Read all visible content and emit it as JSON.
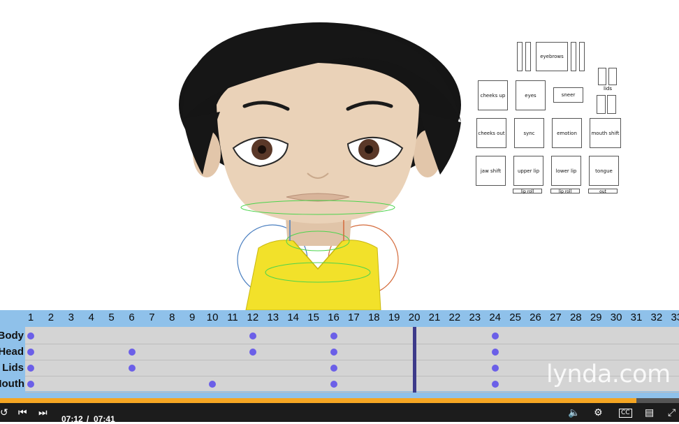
{
  "timeline": {
    "frames": [
      "1",
      "2",
      "3",
      "4",
      "5",
      "6",
      "7",
      "8",
      "9",
      "10",
      "11",
      "12",
      "13",
      "14",
      "15",
      "16",
      "17",
      "18",
      "19",
      "20",
      "21",
      "22",
      "23",
      "24",
      "25",
      "26",
      "27",
      "28",
      "29",
      "30",
      "31",
      "32",
      "33"
    ],
    "tracks": [
      {
        "label": "Body",
        "keys": [
          1,
          12,
          16,
          24
        ]
      },
      {
        "label": "Head",
        "keys": [
          1,
          6,
          12,
          16,
          24
        ]
      },
      {
        "label": "Lids",
        "keys": [
          1,
          6,
          16,
          24
        ]
      },
      {
        "label": "Mouth",
        "keys": [
          1,
          10,
          16,
          24
        ]
      }
    ],
    "current_frame": 20
  },
  "face_controls": {
    "panels": [
      {
        "id": "eyebrows",
        "label": "eyebrows"
      },
      {
        "id": "lids",
        "label": "lids"
      },
      {
        "id": "cheeks-up",
        "label": "cheeks up"
      },
      {
        "id": "eyes",
        "label": "eyes"
      },
      {
        "id": "sneer",
        "label": "sneer"
      },
      {
        "id": "cheeks-out",
        "label": "cheeks out"
      },
      {
        "id": "sync",
        "label": "sync"
      },
      {
        "id": "emotion",
        "label": "emotion"
      },
      {
        "id": "mouth-shift",
        "label": "mouth shift"
      },
      {
        "id": "jaw-shift",
        "label": "jaw shift"
      },
      {
        "id": "upper-lip",
        "label": "upper lip"
      },
      {
        "id": "lower-lip",
        "label": "lower lip"
      },
      {
        "id": "tongue",
        "label": "tongue"
      },
      {
        "id": "lip-roll-upper",
        "label": "lip roll"
      },
      {
        "id": "lip-roll-lower",
        "label": "lip roll"
      },
      {
        "id": "out",
        "label": "out"
      }
    ]
  },
  "watermark": "lynda.com",
  "player": {
    "current_time": "07:12",
    "separator": "/",
    "duration": "07:41",
    "progress": 0.937,
    "cc_label": "CC"
  },
  "colors": {
    "timeline_bg": "#8fc1ea",
    "track_bg": "#d4d4d4",
    "keyframe": "#6b5fe8",
    "playhead": "#3d3a8a",
    "progress": "#f5a623",
    "controls_bg": "#1c1c1c"
  },
  "icons": [
    "replay-icon",
    "skip-back-icon",
    "skip-forward-icon",
    "volume-icon",
    "settings-icon",
    "closed-captions-icon",
    "playlist-icon",
    "fullscreen-icon"
  ]
}
